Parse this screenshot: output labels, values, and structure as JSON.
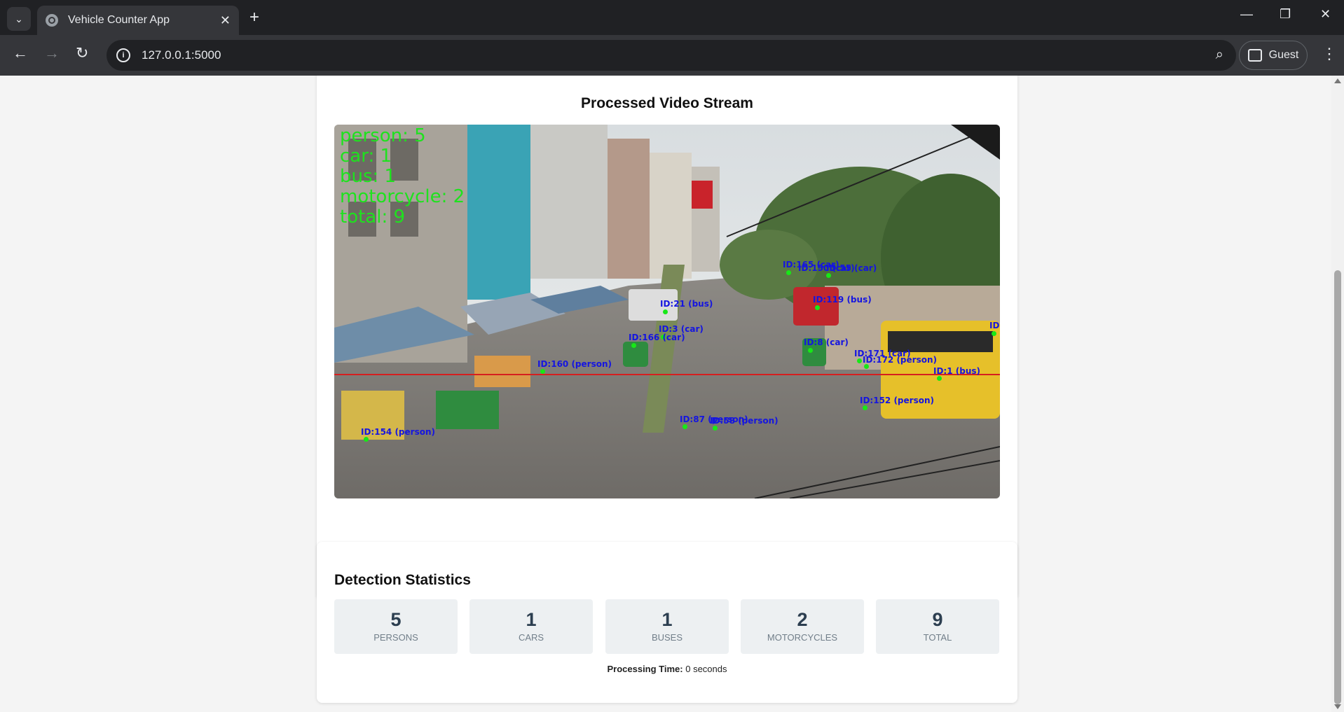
{
  "browser": {
    "tab_title": "Vehicle Counter App",
    "url": "127.0.0.1:5000",
    "profile_label": "Guest"
  },
  "video": {
    "title": "Processed Video Stream",
    "overlay": [
      "person: 5",
      "car: 1",
      "bus: 1",
      "motorcycle: 2",
      "total: 9"
    ],
    "labels": {
      "l1": "ID:165 (car)",
      "l2": "ID:150 (car)",
      "l3": "ID:55 (car)",
      "l4": "ID:119 (bus)",
      "l5": "ID:21 (bus)",
      "l6": "ID:3 (car)",
      "l7": "ID:166 (car)",
      "l8": "ID:8 (car)",
      "l9": "ID:171 (car)",
      "l10": "ID:172 (person)",
      "l11": "ID:1 (bus)",
      "l12": "ID:160 (person)",
      "l13": "ID:152 (person)",
      "l14": "ID:87 (person)",
      "l15": "ID:58 (person)",
      "l16": "ID:154 (person)",
      "l17": "ID:"
    }
  },
  "stats": {
    "title": "Detection Statistics",
    "items": [
      {
        "value": "5",
        "label": "PERSONS"
      },
      {
        "value": "1",
        "label": "CARS"
      },
      {
        "value": "1",
        "label": "BUSES"
      },
      {
        "value": "2",
        "label": "MOTORCYCLES"
      },
      {
        "value": "9",
        "label": "TOTAL"
      }
    ],
    "processing_label": "Processing Time:",
    "processing_value": " 0 seconds"
  },
  "colors": {
    "overlay_text": "#1ee21e",
    "box_label": "#1515e0",
    "counting_line": "#d61f1f",
    "stat_number": "#2c3e50"
  }
}
